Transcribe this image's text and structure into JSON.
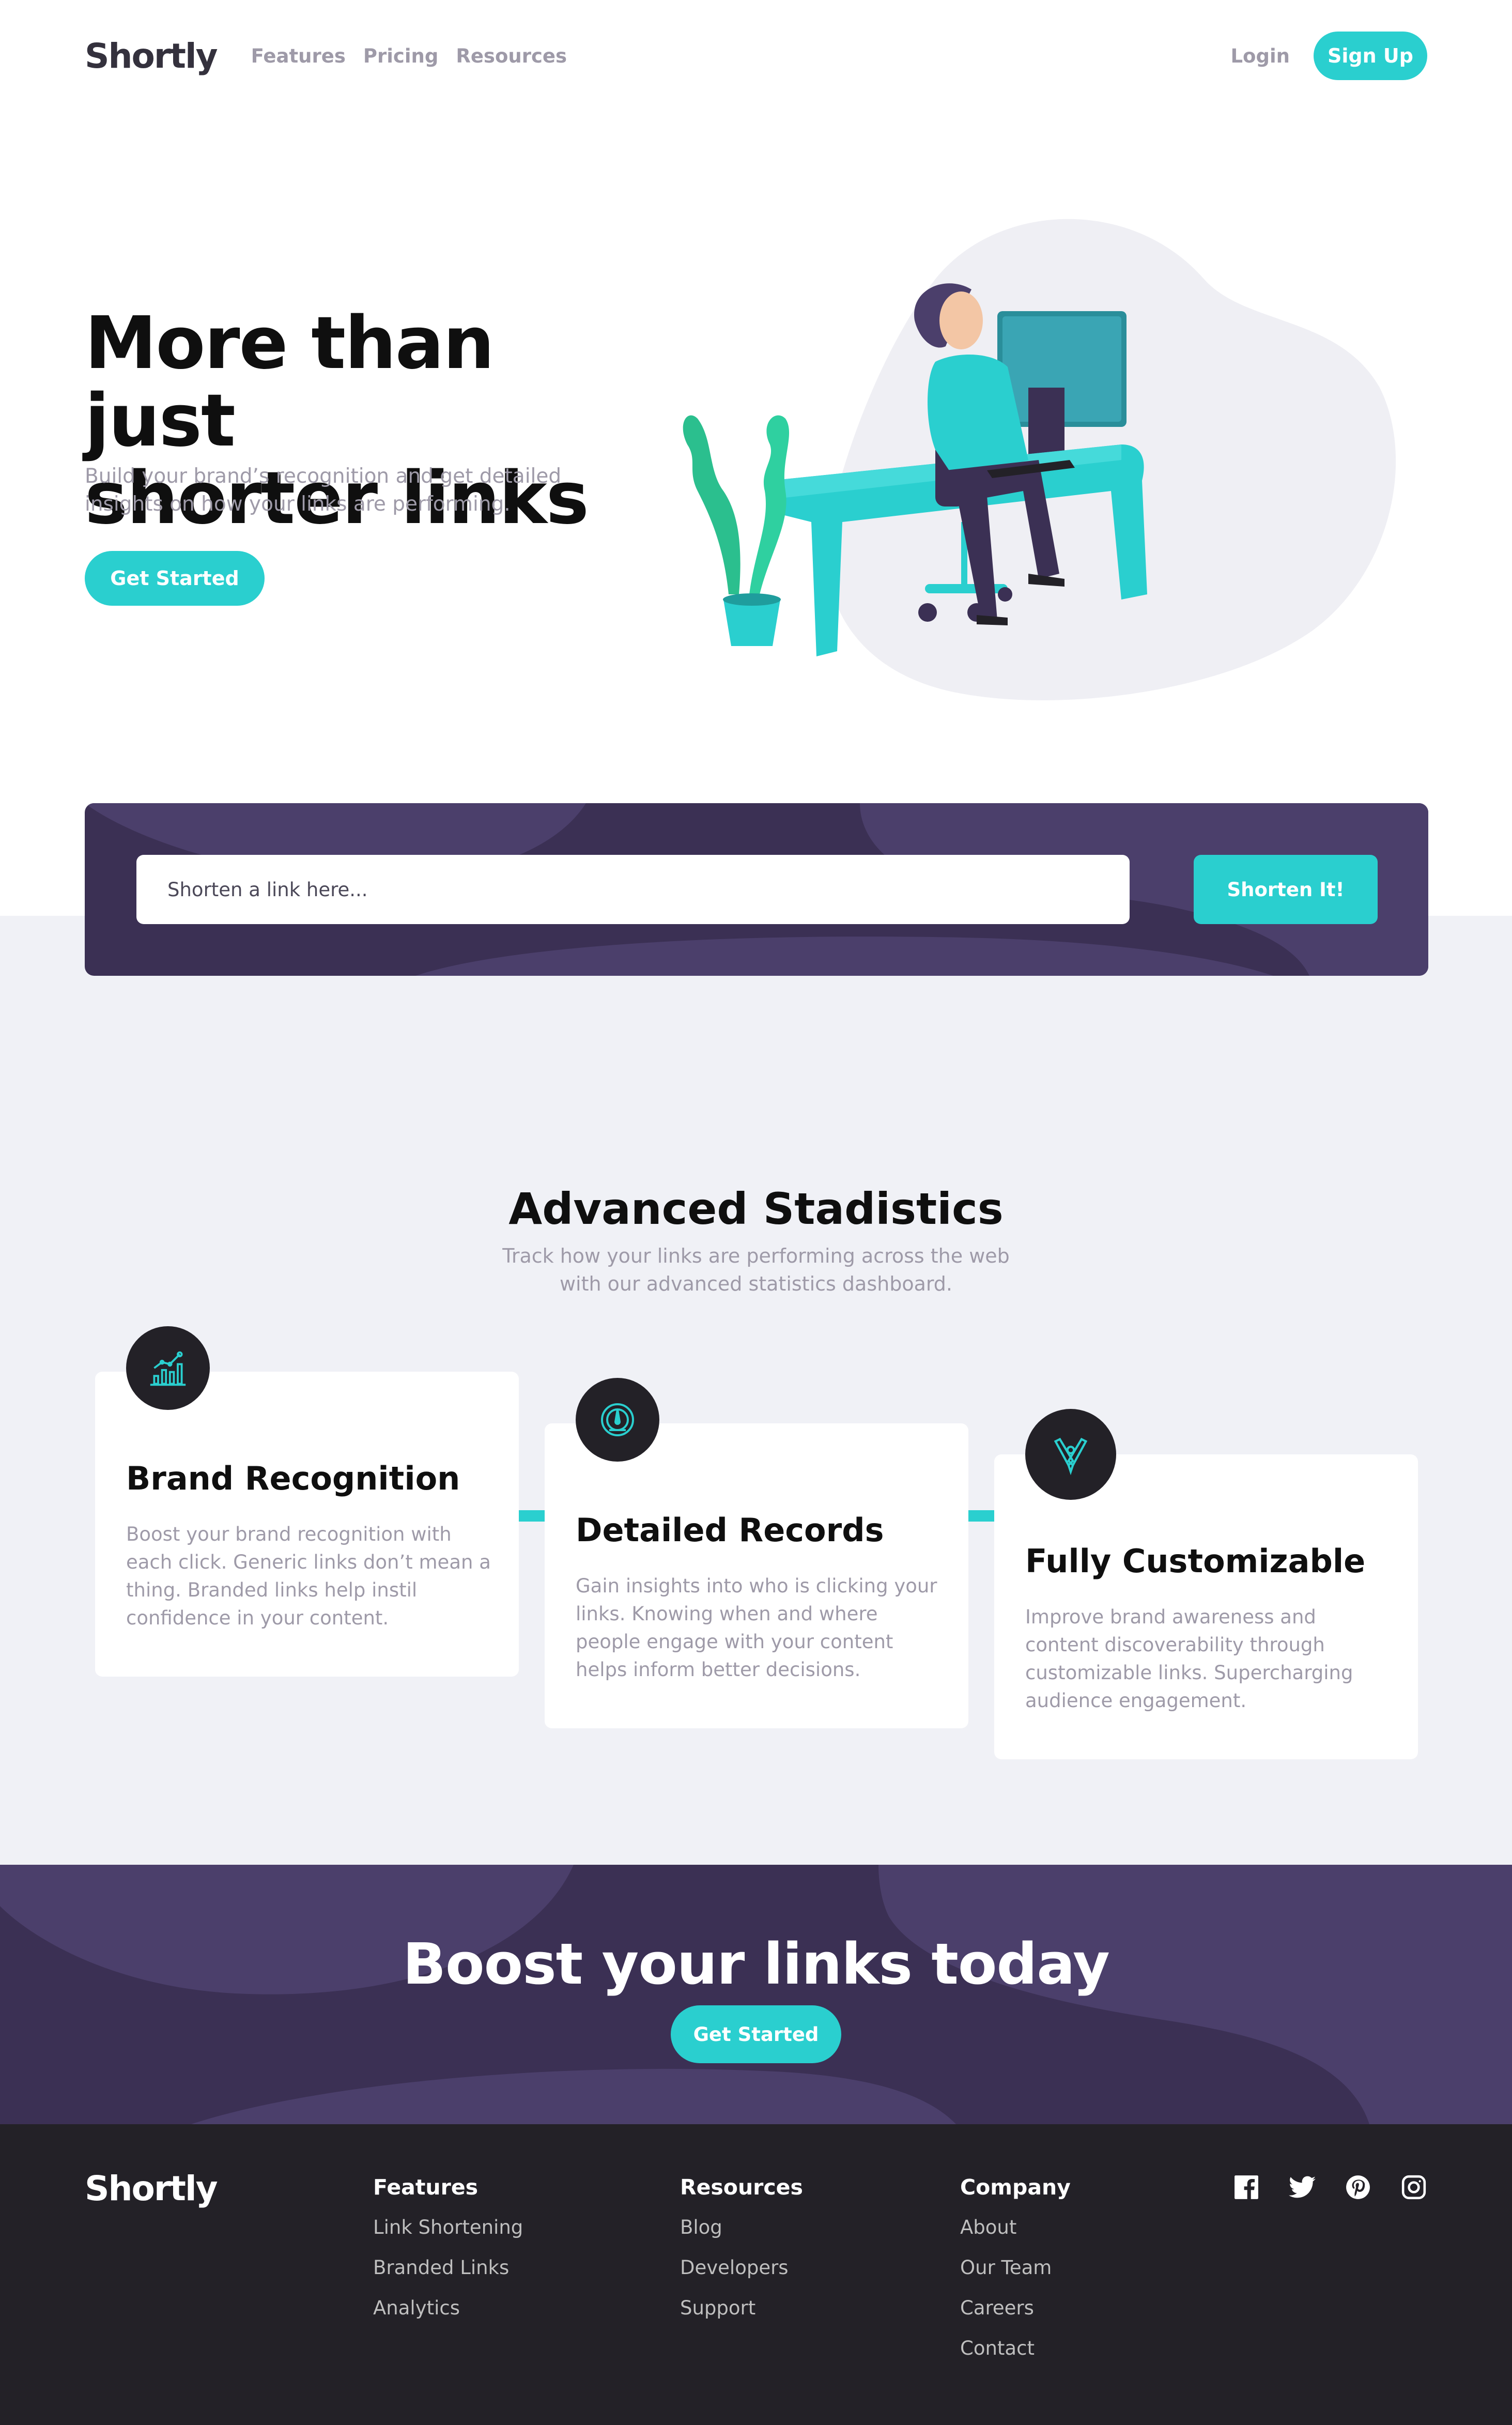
{
  "brand": {
    "logo": "Shortly",
    "accent": "#2acfcf",
    "dark_violet": "#3b3054",
    "footer_bg": "#232127"
  },
  "nav": {
    "items": [
      "Features",
      "Pricing",
      "Resources"
    ],
    "login": "Login",
    "signup": "Sign Up"
  },
  "hero": {
    "title_line1": "More than just",
    "title_line2": "shorter links",
    "subtitle": "Build your brand’s recognition and get detailed insights on how your links are performing.",
    "cta": "Get Started",
    "illustration": "person-working-at-desk"
  },
  "shorten": {
    "placeholder": "Shorten a link here...",
    "button": "Shorten It!"
  },
  "stats": {
    "title": "Advanced Stadistics",
    "subtitle": "Track how your links are performing across the web with our advanced statistics dashboard.",
    "cards": [
      {
        "icon": "brand-recognition-icon",
        "title": "Brand Recognition",
        "text": "Boost your brand recognition with each click. Generic links don’t mean a thing. Branded links help instil confidence in your content."
      },
      {
        "icon": "detailed-records-icon",
        "title": "Detailed Records",
        "text": "Gain insights into who is clicking your links. Knowing when and where people engage with your content helps inform better decisions."
      },
      {
        "icon": "fully-customizable-icon",
        "title": "Fully Customizable",
        "text": "Improve brand awareness and content discoverability through customizable links. Supercharging audience engagement."
      }
    ]
  },
  "boost": {
    "title": "Boost your links today",
    "cta": "Get Started"
  },
  "footer": {
    "logo": "Shortly",
    "columns": [
      {
        "title": "Features",
        "links": [
          "Link Shortening",
          "Branded Links",
          "Analytics"
        ]
      },
      {
        "title": "Resources",
        "links": [
          "Blog",
          "Developers",
          "Support"
        ]
      },
      {
        "title": "Company",
        "links": [
          "About",
          "Our Team",
          "Careers",
          "Contact"
        ]
      }
    ],
    "socials": [
      "facebook-icon",
      "twitter-icon",
      "pinterest-icon",
      "instagram-icon"
    ]
  }
}
